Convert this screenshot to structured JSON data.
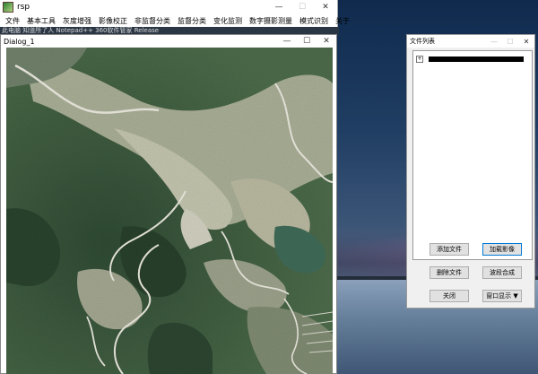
{
  "main_window": {
    "title": "rsp",
    "controls": {
      "minimize": "—",
      "maximize": "☐",
      "close": "✕"
    },
    "menu": [
      "文件",
      "基本工具",
      "灰度增强",
      "影像校正",
      "非监督分类",
      "监督分类",
      "变化监测",
      "数字摄影测量",
      "模式识别",
      "关于"
    ]
  },
  "background_strip": "此电脑     知道所了人    Notepad++    360软件管家    Release",
  "dialog1": {
    "title": "Dialog_1",
    "controls": {
      "minimize": "—",
      "maximize": "☐",
      "close": "✕"
    }
  },
  "file_window": {
    "title": "文件列表",
    "controls": {
      "minimize": "—",
      "maximize": "☐",
      "close": "✕"
    },
    "tree_toggle": "+",
    "buttons": {
      "add_file": "添加文件",
      "load_image": "加载影像",
      "delete_file": "删除文件",
      "band_composite": "波段合成",
      "close": "关闭",
      "window_display": "窗口显示 ▼"
    }
  },
  "colors": {
    "accent": "#0078d7",
    "window_bg": "#f0f0f0"
  }
}
